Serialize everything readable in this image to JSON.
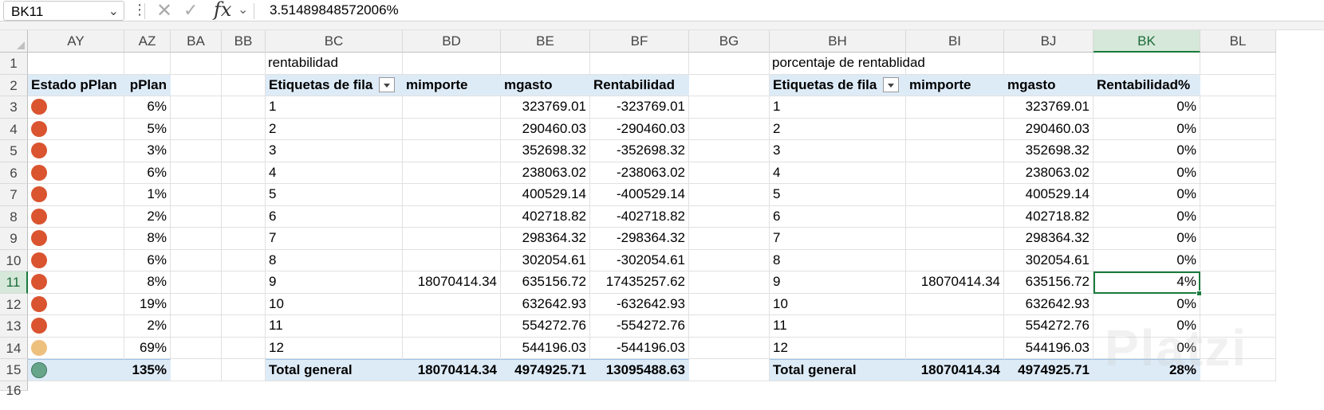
{
  "formula_bar": {
    "name_box": "BK11",
    "content": "3.51489848572006%"
  },
  "columns": [
    "AY",
    "AZ",
    "BA",
    "BB",
    "BC",
    "BD",
    "BE",
    "BF",
    "BG",
    "BH",
    "BI",
    "BJ",
    "BK",
    "BL"
  ],
  "active_column": "BK",
  "active_row": 11,
  "titles": {
    "left": "rentabilidad",
    "right": "porcentaje de rentablidad"
  },
  "plan_table": {
    "headers": [
      "Estado pPlan",
      "pPlan"
    ],
    "rows": [
      {
        "status": "red",
        "value": "6%"
      },
      {
        "status": "red",
        "value": "5%"
      },
      {
        "status": "red",
        "value": "3%"
      },
      {
        "status": "red",
        "value": "6%"
      },
      {
        "status": "red",
        "value": "1%"
      },
      {
        "status": "red",
        "value": "2%"
      },
      {
        "status": "red",
        "value": "8%"
      },
      {
        "status": "red",
        "value": "6%"
      },
      {
        "status": "red",
        "value": "8%"
      },
      {
        "status": "red",
        "value": "19%"
      },
      {
        "status": "red",
        "value": "2%"
      },
      {
        "status": "yellow",
        "value": "69%"
      }
    ],
    "total": {
      "status": "green",
      "value": "135%"
    }
  },
  "status_colors": {
    "red": "#d9542f",
    "yellow": "#eec07e",
    "green": "#67a58a"
  },
  "pivot1": {
    "headers": [
      "Etiquetas de fila",
      "mimporte",
      "mgasto",
      "Rentabilidad"
    ],
    "rows": [
      [
        "1",
        "",
        "323769.01",
        "-323769.01"
      ],
      [
        "2",
        "",
        "290460.03",
        "-290460.03"
      ],
      [
        "3",
        "",
        "352698.32",
        "-352698.32"
      ],
      [
        "4",
        "",
        "238063.02",
        "-238063.02"
      ],
      [
        "5",
        "",
        "400529.14",
        "-400529.14"
      ],
      [
        "6",
        "",
        "402718.82",
        "-402718.82"
      ],
      [
        "7",
        "",
        "298364.32",
        "-298364.32"
      ],
      [
        "8",
        "",
        "302054.61",
        "-302054.61"
      ],
      [
        "9",
        "18070414.34",
        "635156.72",
        "17435257.62"
      ],
      [
        "10",
        "",
        "632642.93",
        "-632642.93"
      ],
      [
        "11",
        "",
        "554272.76",
        "-554272.76"
      ],
      [
        "12",
        "",
        "544196.03",
        "-544196.03"
      ]
    ],
    "total": [
      "Total general",
      "18070414.34",
      "4974925.71",
      "13095488.63"
    ]
  },
  "pivot2": {
    "headers": [
      "Etiquetas de fila",
      "mimporte",
      "mgasto",
      "Rentabilidad%"
    ],
    "rows": [
      [
        "1",
        "",
        "323769.01",
        "0%"
      ],
      [
        "2",
        "",
        "290460.03",
        "0%"
      ],
      [
        "3",
        "",
        "352698.32",
        "0%"
      ],
      [
        "4",
        "",
        "238063.02",
        "0%"
      ],
      [
        "5",
        "",
        "400529.14",
        "0%"
      ],
      [
        "6",
        "",
        "402718.82",
        "0%"
      ],
      [
        "7",
        "",
        "298364.32",
        "0%"
      ],
      [
        "8",
        "",
        "302054.61",
        "0%"
      ],
      [
        "9",
        "18070414.34",
        "635156.72",
        "4%"
      ],
      [
        "10",
        "",
        "632642.93",
        "0%"
      ],
      [
        "11",
        "",
        "554272.76",
        "0%"
      ],
      [
        "12",
        "",
        "544196.03",
        "0%"
      ]
    ],
    "total": [
      "Total general",
      "18070414.34",
      "4974925.71",
      "28%"
    ]
  },
  "watermark": "Platzi"
}
